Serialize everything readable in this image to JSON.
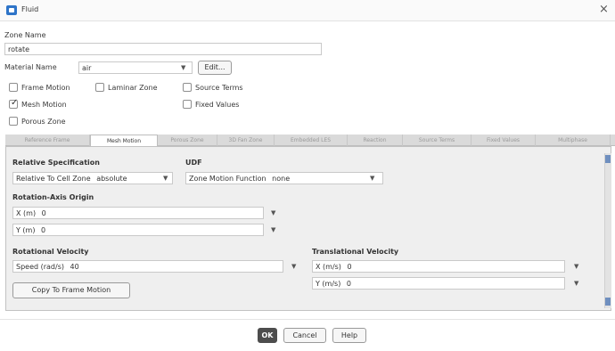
{
  "window": {
    "title": "Fluid",
    "close_symbol": "×"
  },
  "zone": {
    "label": "Zone Name",
    "value": "rotate"
  },
  "material": {
    "label": "Material Name",
    "value": "air",
    "edit_label": "Edit..."
  },
  "options": [
    {
      "label": "Frame Motion",
      "checked": false
    },
    {
      "label": "Laminar Zone",
      "checked": false
    },
    {
      "label": "Source Terms",
      "checked": false
    },
    {
      "label": "Mesh Motion",
      "checked": true
    },
    {
      "label": "Fixed Values",
      "checked": false
    },
    {
      "label": "Porous Zone",
      "checked": false
    }
  ],
  "tabs": [
    "Reference Frame",
    "Mesh Motion",
    "Porous Zone",
    "3D Fan Zone",
    "Embedded LES",
    "Reaction",
    "Source Terms",
    "Fixed Values",
    "Multiphase"
  ],
  "active_tab": "Mesh Motion",
  "relative_spec": {
    "title": "Relative Specification",
    "label": "Relative To Cell Zone",
    "value": "absolute"
  },
  "udf": {
    "title": "UDF",
    "label": "Zone Motion Function",
    "value": "none"
  },
  "rotation_axis_origin": {
    "title": "Rotation-Axis Origin",
    "x": {
      "label": "X (m)",
      "value": "0"
    },
    "y": {
      "label": "Y (m)",
      "value": "0"
    }
  },
  "rotational_velocity": {
    "title": "Rotational Velocity",
    "speed": {
      "label": "Speed (rad/s)",
      "value": "40"
    },
    "copy_button": "Copy To Frame Motion"
  },
  "translational_velocity": {
    "title": "Translational Velocity",
    "x": {
      "label": "X (m/s)",
      "value": "0"
    },
    "y": {
      "label": "Y (m/s)",
      "value": "0"
    }
  },
  "footer": {
    "ok": "OK",
    "cancel": "Cancel",
    "help": "Help"
  },
  "colors": {
    "accent": "#2e74c8",
    "panel_bg": "#efefef",
    "ok_bg": "#4d4d4d"
  },
  "icons": {
    "app": "fluid-dialog-icon",
    "dropdown": "chevron-down-icon",
    "stepper": "parameter-menu-icon"
  }
}
